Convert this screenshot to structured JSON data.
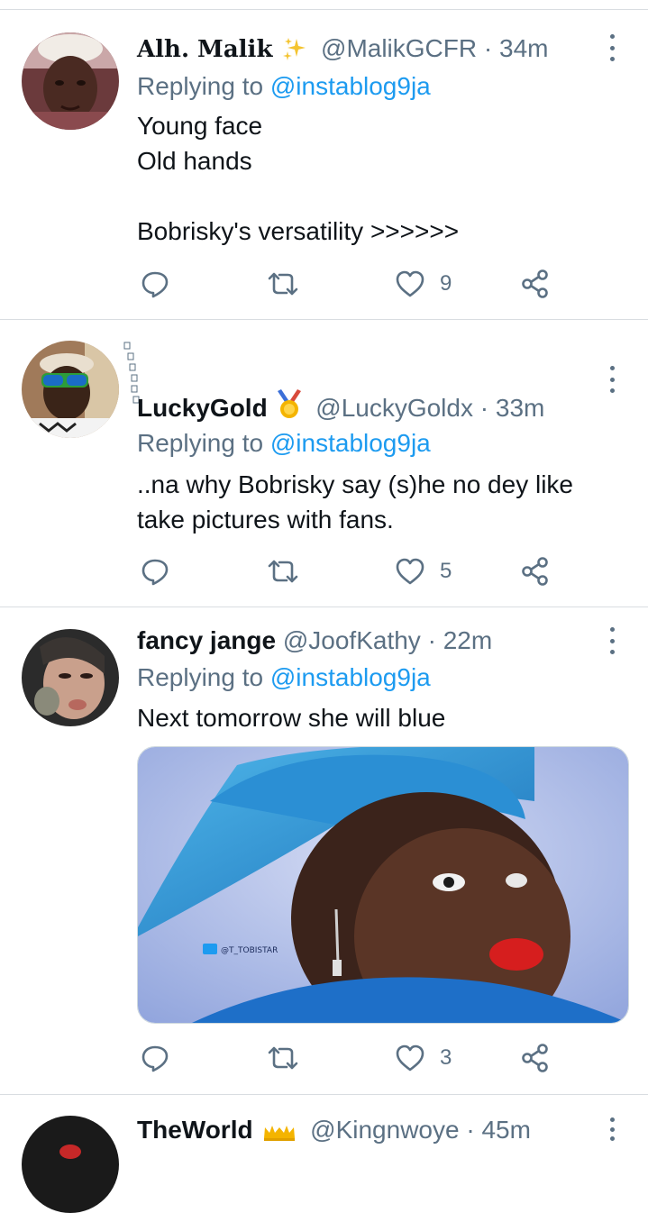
{
  "tweets": [
    {
      "name": "Alh. Malik",
      "badge": "sparkles",
      "handle": "@MalikGCFR",
      "sep": "·",
      "time": "34m",
      "reply_prefix": "Replying to",
      "reply_to": "@instablog9ja",
      "text": "Young face\nOld hands\n\nBobrisky's versatility >>>>>>",
      "likes": "9"
    },
    {
      "name": "LuckyGold",
      "badge": "medal",
      "handle": "@LuckyGoldx",
      "sep": "·",
      "time": "33m",
      "reply_prefix": "Replying to",
      "reply_to": "@instablog9ja",
      "text": "..na why Bobrisky say (s)he no dey like take pictures with fans.",
      "likes": "5"
    },
    {
      "name": "fancy jange",
      "handle": "@JoofKathy",
      "sep": "·",
      "time": "22m",
      "reply_prefix": "Replying to",
      "reply_to": "@instablog9ja",
      "text": "Next tomorrow she will blue",
      "likes": "3",
      "media_watermark": "@T_TOBISTAR"
    },
    {
      "name": "TheWorld",
      "badge": "crowns",
      "handle": "@Kingnwoye",
      "sep": "·",
      "time": "45m"
    }
  ],
  "icons": [
    "reply-icon",
    "retweet-icon",
    "like-icon",
    "share-icon",
    "more-icon"
  ],
  "colors": {
    "accent": "#1d9bf0",
    "secondary_text": "#5b7083",
    "divider": "#d9dde1"
  }
}
